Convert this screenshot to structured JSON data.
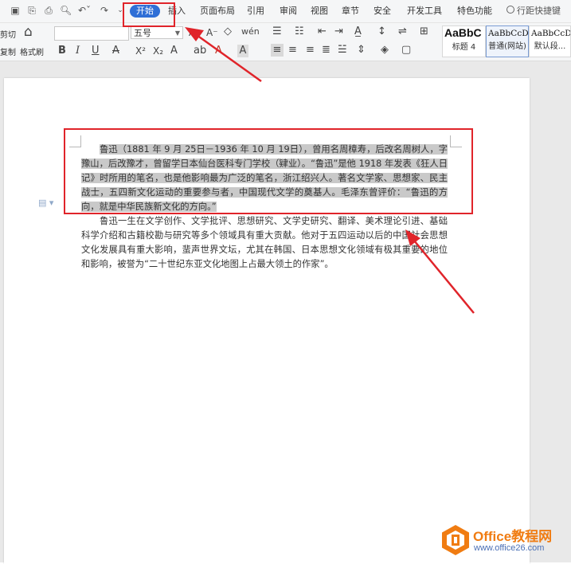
{
  "menu": {
    "tabs": [
      "开始",
      "插入",
      "页面布局",
      "引用",
      "审阅",
      "视图",
      "章节",
      "安全",
      "开发工具",
      "特色功能"
    ],
    "active_tab": "开始",
    "search_label": "行距快捷键",
    "accent_color": "#2f6fd6"
  },
  "ribbon": {
    "clipboard": {
      "cut_label": "剪切",
      "copy_label": "复制",
      "format_painter_label": "格式刷"
    },
    "font_name": "",
    "font_size": "五号",
    "styles": [
      {
        "preview": "AaBbC",
        "name": "标题 4"
      },
      {
        "preview": "AaBbCcD",
        "name": "普通(网站)"
      },
      {
        "preview": "AaBbCcDd",
        "name": "默认段..."
      }
    ]
  },
  "document": {
    "paragraph1": "鲁迅（1881 年 9 月 25日－1936 年 10 月 19日），曾用名周樟寿，后改名周树人，字豫山，后改豫才，曾留学日本仙台医科专门学校（肄业）。“鲁迅”是他 1918 年发表《狂人日记》时所用的笔名，也是他影响最为广泛的笔名，浙江绍兴人。著名文学家、思想家、民主战士，五四新文化运动的重要参与者，中国现代文学的奠基人。毛泽东曾评价：“鲁迅的方向，就是中华民族新文化的方向。”",
    "paragraph2": "鲁迅一生在文学创作、文学批评、思想研究、文学史研究、翻译、美术理论引进、基础科学介绍和古籍校勘与研究等多个领域具有重大贡献。他对于五四运动以后的中国社会思想文化发展具有重大影响，蜚声世界文坛，尤其在韩国、日本思想文化领域有极其重要的地位和影响，被誉为“二十世纪东亚文化地图上占最大领土的作家”。"
  },
  "annotation_color": "#e0242a",
  "watermark": {
    "title": "Office教程网",
    "url": "www.office26.com"
  }
}
